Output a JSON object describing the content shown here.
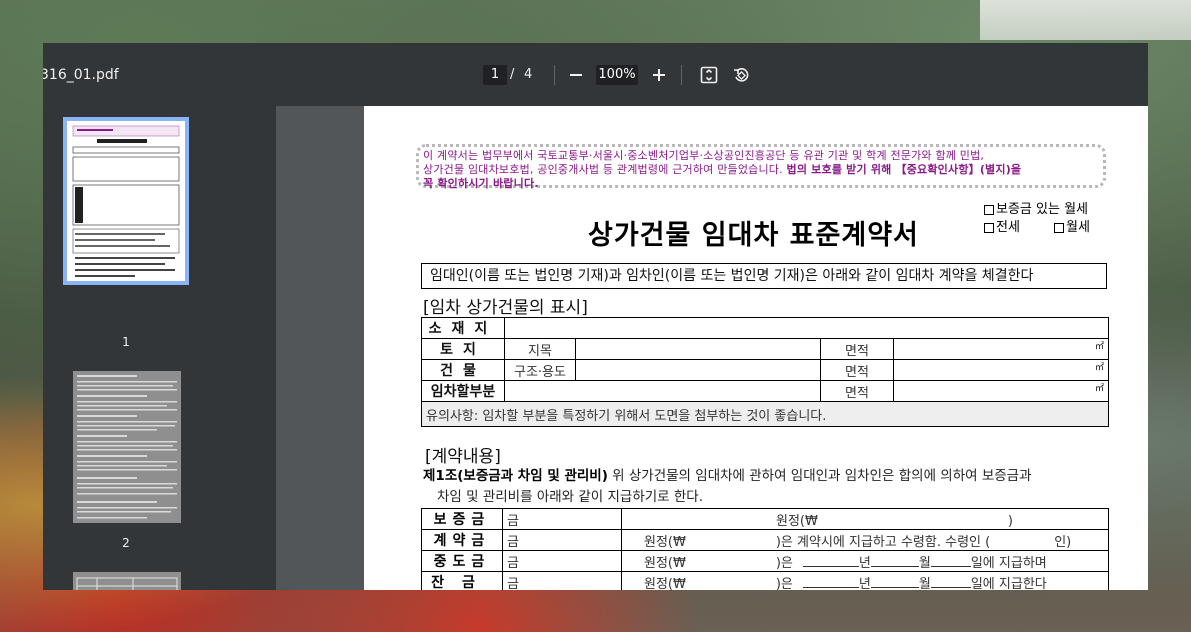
{
  "viewer": {
    "filename": "316_01.pdf",
    "current_page": "1",
    "page_separator": "/",
    "total_pages": "4",
    "zoom": "100%"
  },
  "thumbnails": [
    {
      "number": "1"
    },
    {
      "number": "2"
    },
    {
      "number": ""
    }
  ],
  "document": {
    "notice_line1": "이 계약서는 법무부에서 국토교통부·서울시·중소벤처기업부·소상공인진흥공단 등 유관 기관 및 학계 전문가와 함께 민법,",
    "notice_line2_plain": "상가건물 임대차보호법, 공인중개사법 등 관계법령에 근거하여 만들었습니다. ",
    "notice_line2_bold": "법의 보호를 받기 위해 【중요확인사항】(별지)을",
    "notice_line3_bold": "꼭 확인하시기 바랍니다.",
    "title": "상가건물 임대차 표준계약서",
    "option_deposit_monthly": "보증금 있는 월세",
    "option_jeonse": "전세",
    "option_monthly": "월세",
    "intro": "임대인(이름 또는 법인명 기재)과 임차인(이름 또는 법인명 기재)은 아래와 같이 임대차 계약을 체결한다",
    "section_property": "[임차 상가건물의 표시]",
    "property_table": {
      "location_label": "소재지",
      "land_label": "토지",
      "land_sub": "지목",
      "building_label": "건물",
      "building_sub": "구조·용도",
      "leased_label": "임차할부분",
      "area_label": "면적",
      "unit": "㎡",
      "note": "유의사항: 임차할 부분을 특정하기 위해서 도면을 첨부하는 것이 좋습니다."
    },
    "section_contract": "[계약내용]",
    "article1_title": "제1조(보증금과 차임 및 관리비)",
    "article1_text": " 위 상가건물의 임대차에 관하여 임대인과 임차인은 합의에 의하여 보증금과",
    "article1_text2": "차임 및 관리비를 아래와 같이 지급하기로 한다.",
    "payment_table": {
      "rows": [
        {
          "label": "보증금",
          "c1": "금",
          "c2": "원정(₩",
          "c3": ")"
        },
        {
          "label": "계약금",
          "c1": "금",
          "c2": "원정(₩",
          "c3": ")은 계약시에 지급하고 수령함. 수령인 (",
          "c4": "인)"
        },
        {
          "label": "중도금",
          "c1": "금",
          "c2": "원정(₩",
          "c3": ")은",
          "c4": "년",
          "c5": "월",
          "c6": "일에 지급하며"
        },
        {
          "label": "잔금",
          "c1": "금",
          "c2": "원정(₩",
          "c3": ")은",
          "c4": "년",
          "c5": "월",
          "c6": "일에 지급한다"
        }
      ]
    }
  }
}
